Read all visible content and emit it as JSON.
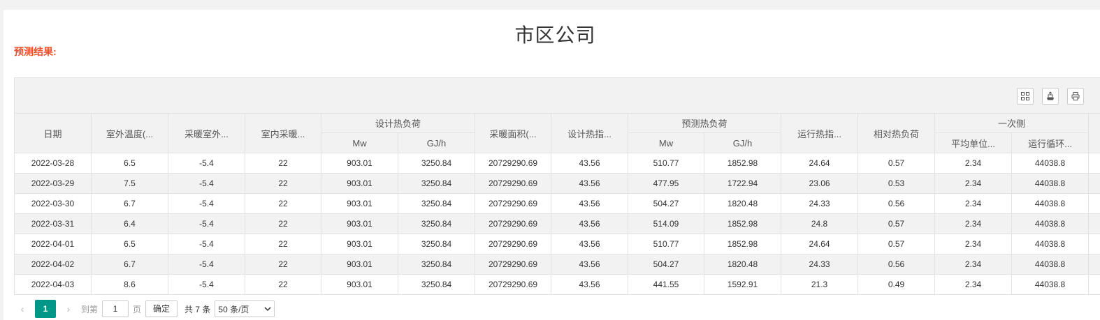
{
  "page_title": "市区公司",
  "subtitle": "预测结果:",
  "toolbar": {
    "icons": [
      "columns-icon",
      "export-icon",
      "print-icon"
    ]
  },
  "table": {
    "headers": {
      "date": "日期",
      "outdoor_temp": "室外温度(...",
      "heating_outdoor": "采暖室外...",
      "indoor_heating": "室内采暖...",
      "design_load": "设计热负荷",
      "design_load_mw": "Mw",
      "design_load_gj": "GJ/h",
      "heating_area": "采暖面积(...",
      "design_index": "设计热指...",
      "predicted_load": "预测热负荷",
      "predicted_load_mw": "Mw",
      "predicted_load_gj": "GJ/h",
      "running_index": "运行热指...",
      "relative_load": "相对热负荷",
      "primary_side": "一次侧",
      "avg_unit": "平均单位...",
      "running_cycle": "运行循环..."
    },
    "rows": [
      [
        "2022-03-28",
        "6.5",
        "-5.4",
        "22",
        "903.01",
        "3250.84",
        "20729290.69",
        "43.56",
        "510.77",
        "1852.98",
        "24.64",
        "0.57",
        "2.34",
        "44038.8"
      ],
      [
        "2022-03-29",
        "7.5",
        "-5.4",
        "22",
        "903.01",
        "3250.84",
        "20729290.69",
        "43.56",
        "477.95",
        "1722.94",
        "23.06",
        "0.53",
        "2.34",
        "44038.8"
      ],
      [
        "2022-03-30",
        "6.7",
        "-5.4",
        "22",
        "903.01",
        "3250.84",
        "20729290.69",
        "43.56",
        "504.27",
        "1820.48",
        "24.33",
        "0.56",
        "2.34",
        "44038.8"
      ],
      [
        "2022-03-31",
        "6.4",
        "-5.4",
        "22",
        "903.01",
        "3250.84",
        "20729290.69",
        "43.56",
        "514.09",
        "1852.98",
        "24.8",
        "0.57",
        "2.34",
        "44038.8"
      ],
      [
        "2022-04-01",
        "6.5",
        "-5.4",
        "22",
        "903.01",
        "3250.84",
        "20729290.69",
        "43.56",
        "510.77",
        "1852.98",
        "24.64",
        "0.57",
        "2.34",
        "44038.8"
      ],
      [
        "2022-04-02",
        "6.7",
        "-5.4",
        "22",
        "903.01",
        "3250.84",
        "20729290.69",
        "43.56",
        "504.27",
        "1820.48",
        "24.33",
        "0.56",
        "2.34",
        "44038.8"
      ],
      [
        "2022-04-03",
        "8.6",
        "-5.4",
        "22",
        "903.01",
        "3250.84",
        "20729290.69",
        "43.56",
        "441.55",
        "1592.91",
        "21.3",
        "0.49",
        "2.34",
        "44038.8"
      ]
    ]
  },
  "pagination": {
    "current_page": "1",
    "goto_label": "到第",
    "page_input": "1",
    "page_unit": "页",
    "confirm_label": "确定",
    "total_label": "共 7 条",
    "page_size": "50 条/页"
  },
  "colors": {
    "accent": "#009688",
    "subtitle": "#e8542d"
  }
}
